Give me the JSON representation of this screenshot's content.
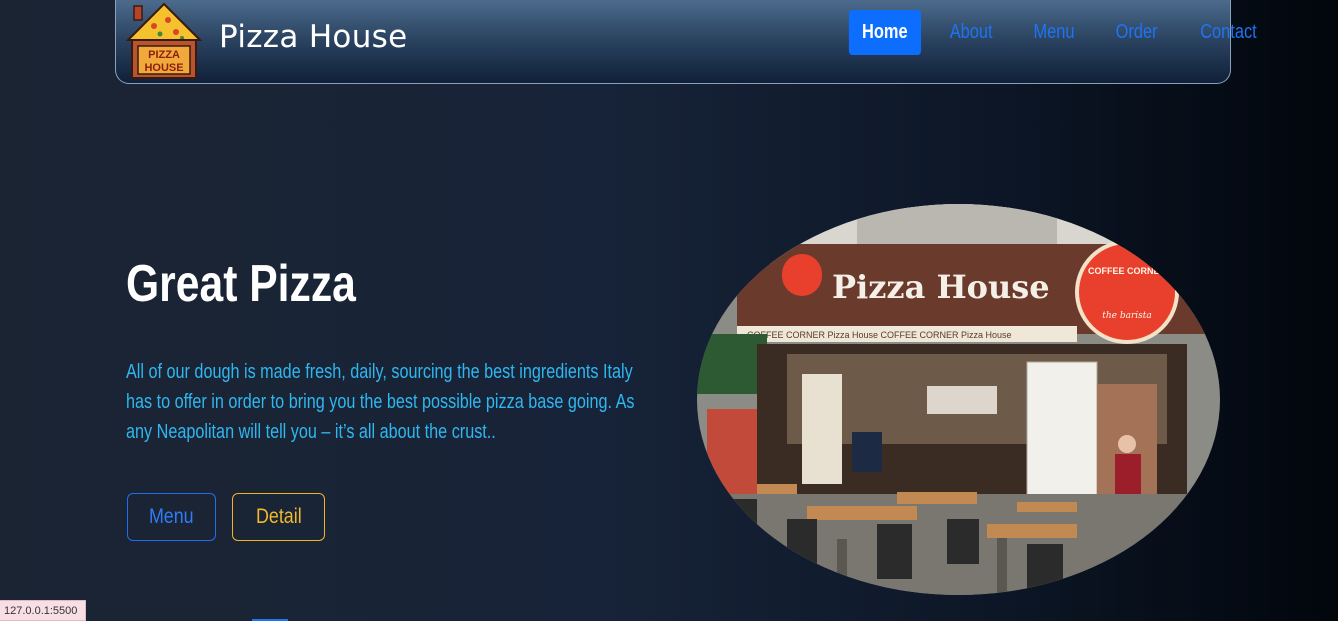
{
  "brand": {
    "name": "Pizza House",
    "logo_text_line1": "PIZZA",
    "logo_text_line2": "HOUSE"
  },
  "nav": {
    "items": [
      {
        "label": "Home",
        "active": true
      },
      {
        "label": "About",
        "active": false
      },
      {
        "label": "Menu",
        "active": false
      },
      {
        "label": "Order",
        "active": false
      },
      {
        "label": "Contact",
        "active": false
      }
    ]
  },
  "hero": {
    "title": "Great Pizza",
    "text": "All of our dough is made fresh, daily, sourcing the best ingredients Italy has to offer in order to bring you the best possible pizza base going. As any Neapolitan will tell you – it’s all about the crust..",
    "buttons": {
      "menu": "Menu",
      "detail": "Detail"
    }
  },
  "photo": {
    "sign_main": "Pizza House",
    "sign_side_top": "COFFEE CORNER",
    "sign_side_bottom": "the barista",
    "awning": "COFFEE CORNER   Pizza House   COFFEE CORNER   Pizza House"
  },
  "status": {
    "url": "127.0.0.1:5500"
  },
  "colors": {
    "accent_blue": "#0d6efd",
    "text_cyan": "#2fb7f0",
    "detail_yellow": "#f2b92d"
  }
}
